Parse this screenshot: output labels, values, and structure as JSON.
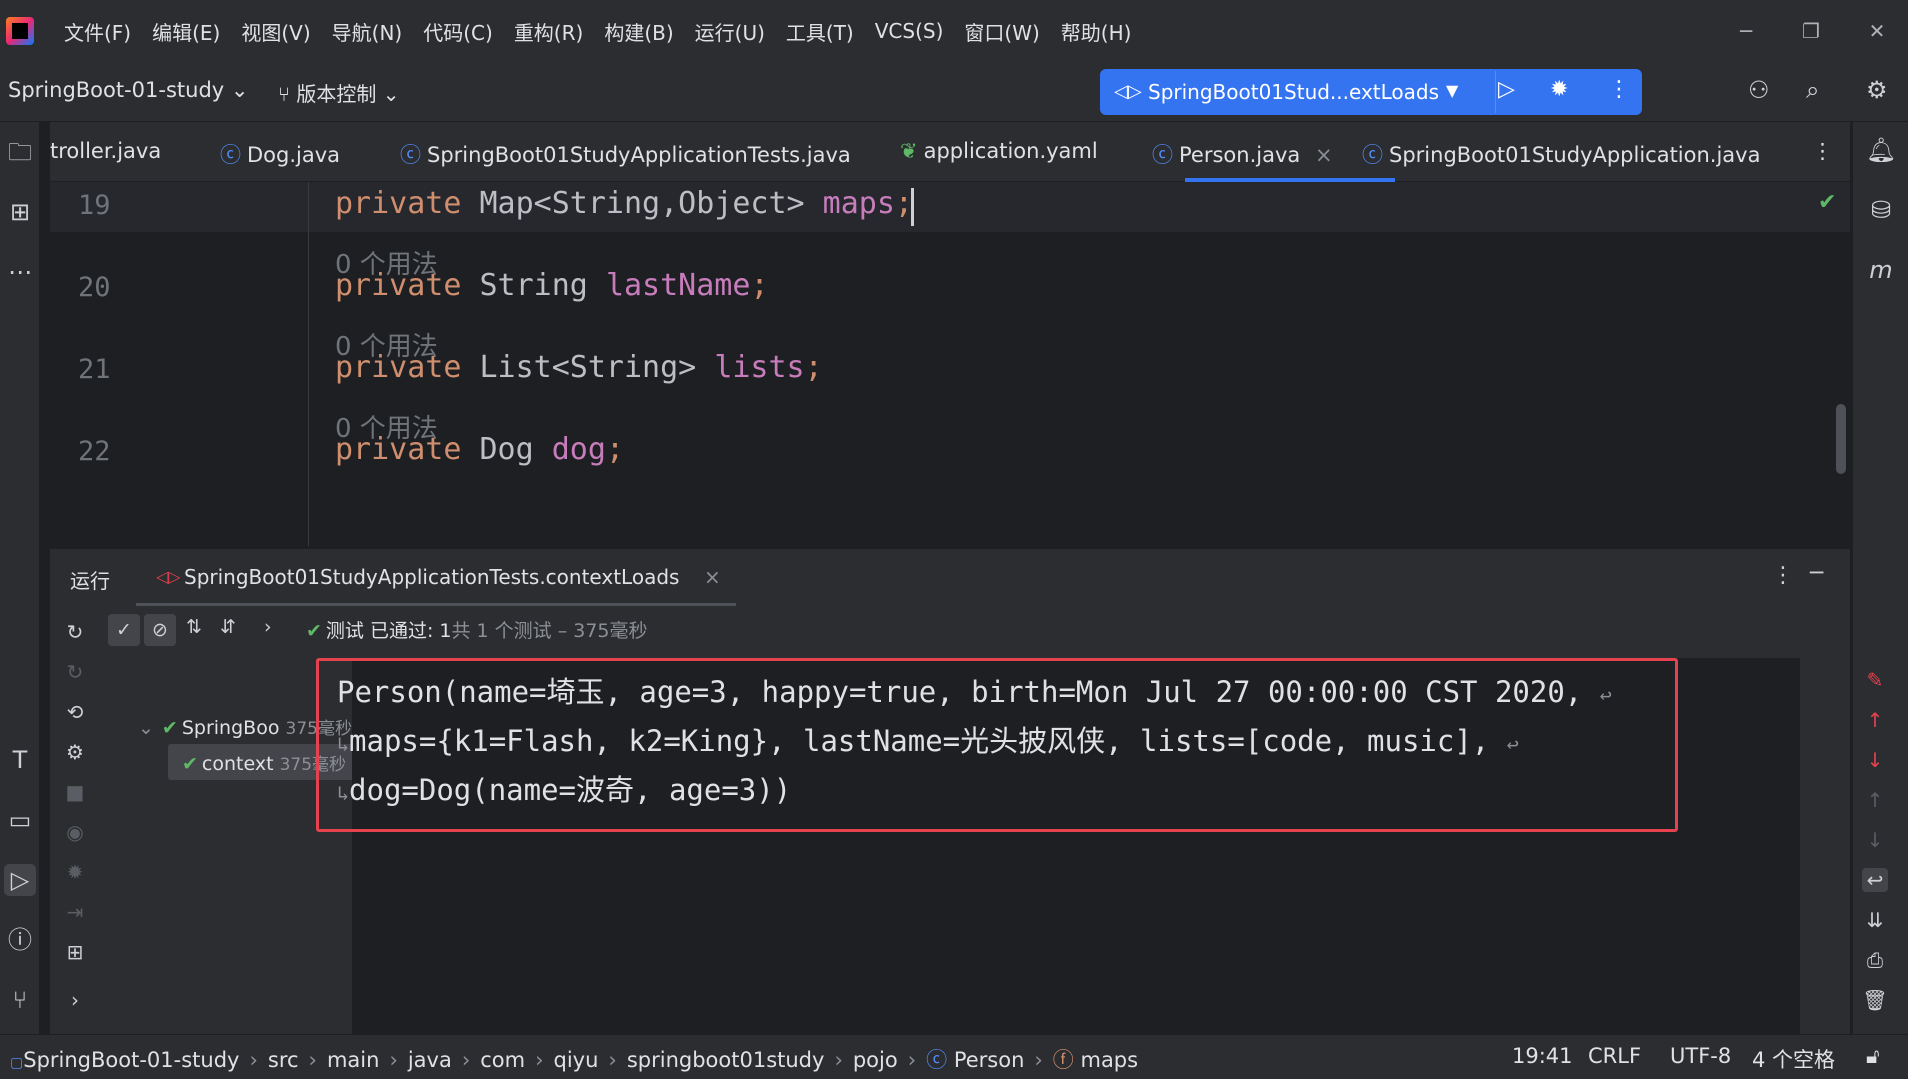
{
  "menu": [
    "文件(F)",
    "编辑(E)",
    "视图(V)",
    "导航(N)",
    "代码(C)",
    "重构(R)",
    "构建(B)",
    "运行(U)",
    "工具(T)",
    "VCS(S)",
    "窗口(W)",
    "帮助(H)"
  ],
  "toolbar": {
    "project": "SpringBoot-01-study",
    "vcs": "版本控制",
    "run_config": "SpringBoot01Stud...extLoads"
  },
  "tabs": [
    {
      "label": "troller.java"
    },
    {
      "label": "Dog.java"
    },
    {
      "label": "SpringBoot01StudyApplicationTests.java"
    },
    {
      "label": "application.yaml"
    },
    {
      "label": "Person.java"
    },
    {
      "label": "SpringBoot01StudyApplication.java"
    }
  ],
  "editor": {
    "lines": [
      {
        "num": "19",
        "kw": "private",
        "type": "Map<String,Object>",
        "field": "maps",
        "end": ";"
      },
      {
        "num": "20",
        "kw": "private",
        "type": "String",
        "field": "lastName",
        "end": ";"
      },
      {
        "num": "21",
        "kw": "private",
        "type": "List<String>",
        "field": "lists",
        "end": ";"
      },
      {
        "num": "22",
        "kw": "private",
        "type": "Dog",
        "field": "dog",
        "end": ";"
      }
    ],
    "usage_hint": "0 个用法"
  },
  "run": {
    "title": "运行",
    "tab": "SpringBoot01StudyApplicationTests.contextLoads",
    "status_prefix": "测试 已通过: 1",
    "status_suffix": "共 1 个测试 – 375毫秒",
    "tree": [
      {
        "label": "SpringBoo",
        "time": "375毫秒"
      },
      {
        "label": "context",
        "time": "375毫秒"
      }
    ],
    "output": [
      "Person(name=埼玉, age=3, happy=true, birth=Mon Jul 27 00:00:00 CST 2020,",
      "maps={k1=Flash, k2=King}, lastName=光头披风侠, lists=[code, music],",
      "dog=Dog(name=波奇, age=3))"
    ]
  },
  "status": {
    "breadcrumb": [
      "SpringBoot-01-study",
      "src",
      "main",
      "java",
      "com",
      "qiyu",
      "springboot01study",
      "pojo",
      "Person",
      "maps"
    ],
    "position": "19:41",
    "line_sep": "CRLF",
    "encoding": "UTF-8",
    "indent": "4 个空格"
  },
  "colors": {
    "accent": "#3574f0",
    "keyword": "#cf8e6d",
    "field": "#c77dbb",
    "highlight_border": "#e5414f",
    "pass": "#5fb865"
  }
}
